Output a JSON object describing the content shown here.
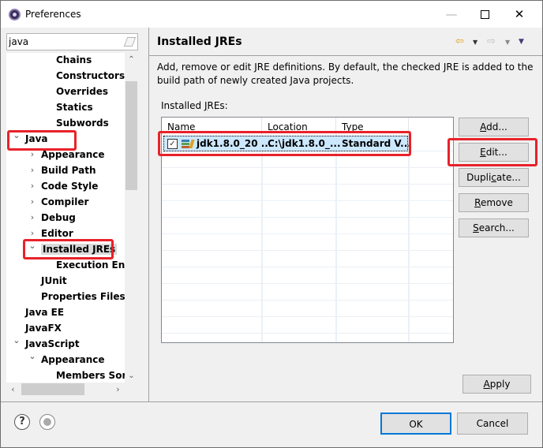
{
  "window": {
    "title": "Preferences",
    "minimize_glyph": "—",
    "close_glyph": "✕"
  },
  "sidebar": {
    "filter_value": "java",
    "tree": [
      {
        "label": "Chains",
        "level": 3,
        "twisty": ""
      },
      {
        "label": "Constructors",
        "level": 3,
        "twisty": ""
      },
      {
        "label": "Overrides",
        "level": 3,
        "twisty": ""
      },
      {
        "label": "Statics",
        "level": 3,
        "twisty": ""
      },
      {
        "label": "Subwords",
        "level": 3,
        "twisty": ""
      },
      {
        "label": "Java",
        "level": 1,
        "twisty": "expanded"
      },
      {
        "label": "Appearance",
        "level": 2,
        "twisty": "collapsed"
      },
      {
        "label": "Build Path",
        "level": 2,
        "twisty": "collapsed"
      },
      {
        "label": "Code Style",
        "level": 2,
        "twisty": "collapsed"
      },
      {
        "label": "Compiler",
        "level": 2,
        "twisty": "collapsed"
      },
      {
        "label": "Debug",
        "level": 2,
        "twisty": "collapsed"
      },
      {
        "label": "Editor",
        "level": 2,
        "twisty": "collapsed"
      },
      {
        "label": "Installed JREs",
        "level": 2,
        "twisty": "expanded",
        "selected": true
      },
      {
        "label": "Execution Env",
        "level": 3,
        "twisty": ""
      },
      {
        "label": "JUnit",
        "level": 2,
        "twisty": ""
      },
      {
        "label": "Properties Files E",
        "level": 2,
        "twisty": ""
      },
      {
        "label": "Java EE",
        "level": 1,
        "twisty": ""
      },
      {
        "label": "JavaFX",
        "level": 1,
        "twisty": ""
      },
      {
        "label": "JavaScript",
        "level": 1,
        "twisty": "expanded"
      },
      {
        "label": "Appearance",
        "level": 2,
        "twisty": "expanded"
      },
      {
        "label": "Members Sort",
        "level": 3,
        "twisty": ""
      }
    ],
    "twisty_glyphs": {
      "expanded": "⌄",
      "collapsed": "›"
    }
  },
  "page": {
    "title": "Installed JREs",
    "description": "Add, remove or edit JRE definitions. By default, the checked JRE is added to the build path of newly created Java projects.",
    "list_label_pre": "Installed ",
    "list_label_mnemonic": "J",
    "list_label_post": "REs:",
    "table": {
      "columns": [
        "Name",
        "Location",
        "Type"
      ],
      "rows": [
        {
          "checked": true,
          "name": "jdk1.8.0_20 ...",
          "location": "C:\\jdk1.8.0_...",
          "type": "Standard V..."
        }
      ]
    },
    "buttons": {
      "add": {
        "mnemonic": "A",
        "rest": "dd..."
      },
      "edit": {
        "mnemonic": "E",
        "rest": "dit..."
      },
      "duplicate": {
        "pre": "Dupli",
        "mnemonic": "c",
        "rest": "ate..."
      },
      "remove": {
        "mnemonic": "R",
        "rest": "emove"
      },
      "search": {
        "mnemonic": "S",
        "rest": "earch..."
      }
    },
    "apply": {
      "mnemonic": "A",
      "rest": "pply"
    }
  },
  "footer": {
    "ok_label": "OK",
    "cancel_label": "Cancel"
  },
  "colors": {
    "highlight": "#e8222a",
    "selection": "#cce8ff",
    "default_button_border": "#0078d7"
  }
}
